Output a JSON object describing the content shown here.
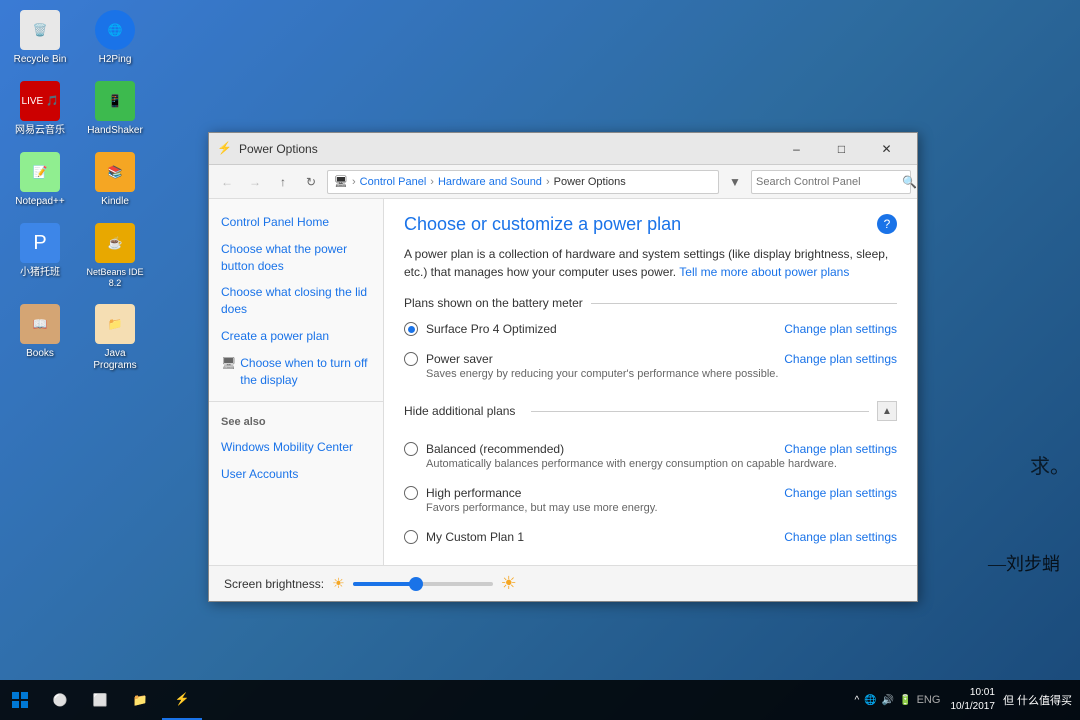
{
  "desktop": {
    "icons": [
      [
        {
          "id": "recycle-bin",
          "label": "Recycle Bin",
          "color": "#e0e0e0",
          "symbol": "🗑"
        },
        {
          "id": "h2ping",
          "label": "H2Ping",
          "color": "#1a73e8",
          "symbol": "🌐"
        }
      ],
      [
        {
          "id": "wangyi-music",
          "label": "网易云音乐",
          "color": "#e83131",
          "symbol": "🎵"
        },
        {
          "id": "handshaker",
          "label": "HandShaker",
          "color": "#3dba4e",
          "symbol": "📱"
        }
      ],
      [
        {
          "id": "notepad",
          "label": "Notepad++",
          "color": "#90EE90",
          "symbol": "📝"
        },
        {
          "id": "kindle",
          "label": "Kindle",
          "color": "#f5a623",
          "symbol": "📚"
        }
      ],
      [
        {
          "id": "xiao-zhu",
          "label": "小猪托班",
          "color": "#3d86e8",
          "symbol": "🐷"
        },
        {
          "id": "netbeans",
          "label": "NetBeans IDE 8.2",
          "color": "#e8a800",
          "symbol": "☕"
        }
      ],
      [
        {
          "id": "books",
          "label": "Books",
          "color": "#8B4513",
          "symbol": "📖"
        },
        {
          "id": "java-programs",
          "label": "Java Programs",
          "color": "#e87025",
          "symbol": "📁"
        }
      ]
    ]
  },
  "taskbar": {
    "time": "10:01",
    "date": "10/1/2017",
    "corner_text": "但 什么值得买"
  },
  "window": {
    "title": "Power Options",
    "breadcrumb": {
      "parts": [
        "Control Panel",
        "Hardware and Sound",
        "Power Options"
      ]
    },
    "search_placeholder": "Search Control Panel",
    "sidebar": {
      "items": [
        {
          "id": "control-panel-home",
          "label": "Control Panel Home"
        },
        {
          "id": "power-button",
          "label": "Choose what the power button does"
        },
        {
          "id": "closing-lid",
          "label": "Choose what closing the lid does"
        },
        {
          "id": "create-power-plan",
          "label": "Create a power plan"
        },
        {
          "id": "turn-off-display",
          "label": "Choose when to turn off the display",
          "has_icon": true
        }
      ],
      "see_also_label": "See also",
      "see_also_items": [
        {
          "id": "windows-mobility",
          "label": "Windows Mobility Center"
        },
        {
          "id": "user-accounts",
          "label": "User Accounts"
        }
      ]
    },
    "main": {
      "title": "Choose or customize a power plan",
      "description": "A power plan is a collection of hardware and system settings (like display brightness, sleep, etc.) that manages how your computer uses power.",
      "learn_more_text": "Tell me more about power plans",
      "plans_section_label": "Plans shown on the battery meter",
      "plans": [
        {
          "id": "surface-pro-4",
          "name": "Surface Pro 4 Optimized",
          "description": "",
          "selected": true,
          "change_link": "Change plan settings"
        },
        {
          "id": "power-saver",
          "name": "Power saver",
          "description": "Saves energy by reducing your computer's performance where possible.",
          "selected": false,
          "change_link": "Change plan settings"
        }
      ],
      "hide_section_label": "Hide additional plans",
      "additional_plans": [
        {
          "id": "balanced",
          "name": "Balanced (recommended)",
          "description": "Automatically balances performance with energy consumption on capable hardware.",
          "selected": false,
          "change_link": "Change plan settings"
        },
        {
          "id": "high-performance",
          "name": "High performance",
          "description": "Favors performance, but may use more energy.",
          "selected": false,
          "change_link": "Change plan settings"
        },
        {
          "id": "custom-plan",
          "name": "My Custom Plan 1",
          "description": "",
          "selected": false,
          "change_link": "Change plan settings"
        }
      ]
    },
    "brightness": {
      "label": "Screen brightness:",
      "value": 45
    }
  },
  "annotations": {
    "side_text": "求。",
    "side_text2": "—刘步蛸"
  }
}
